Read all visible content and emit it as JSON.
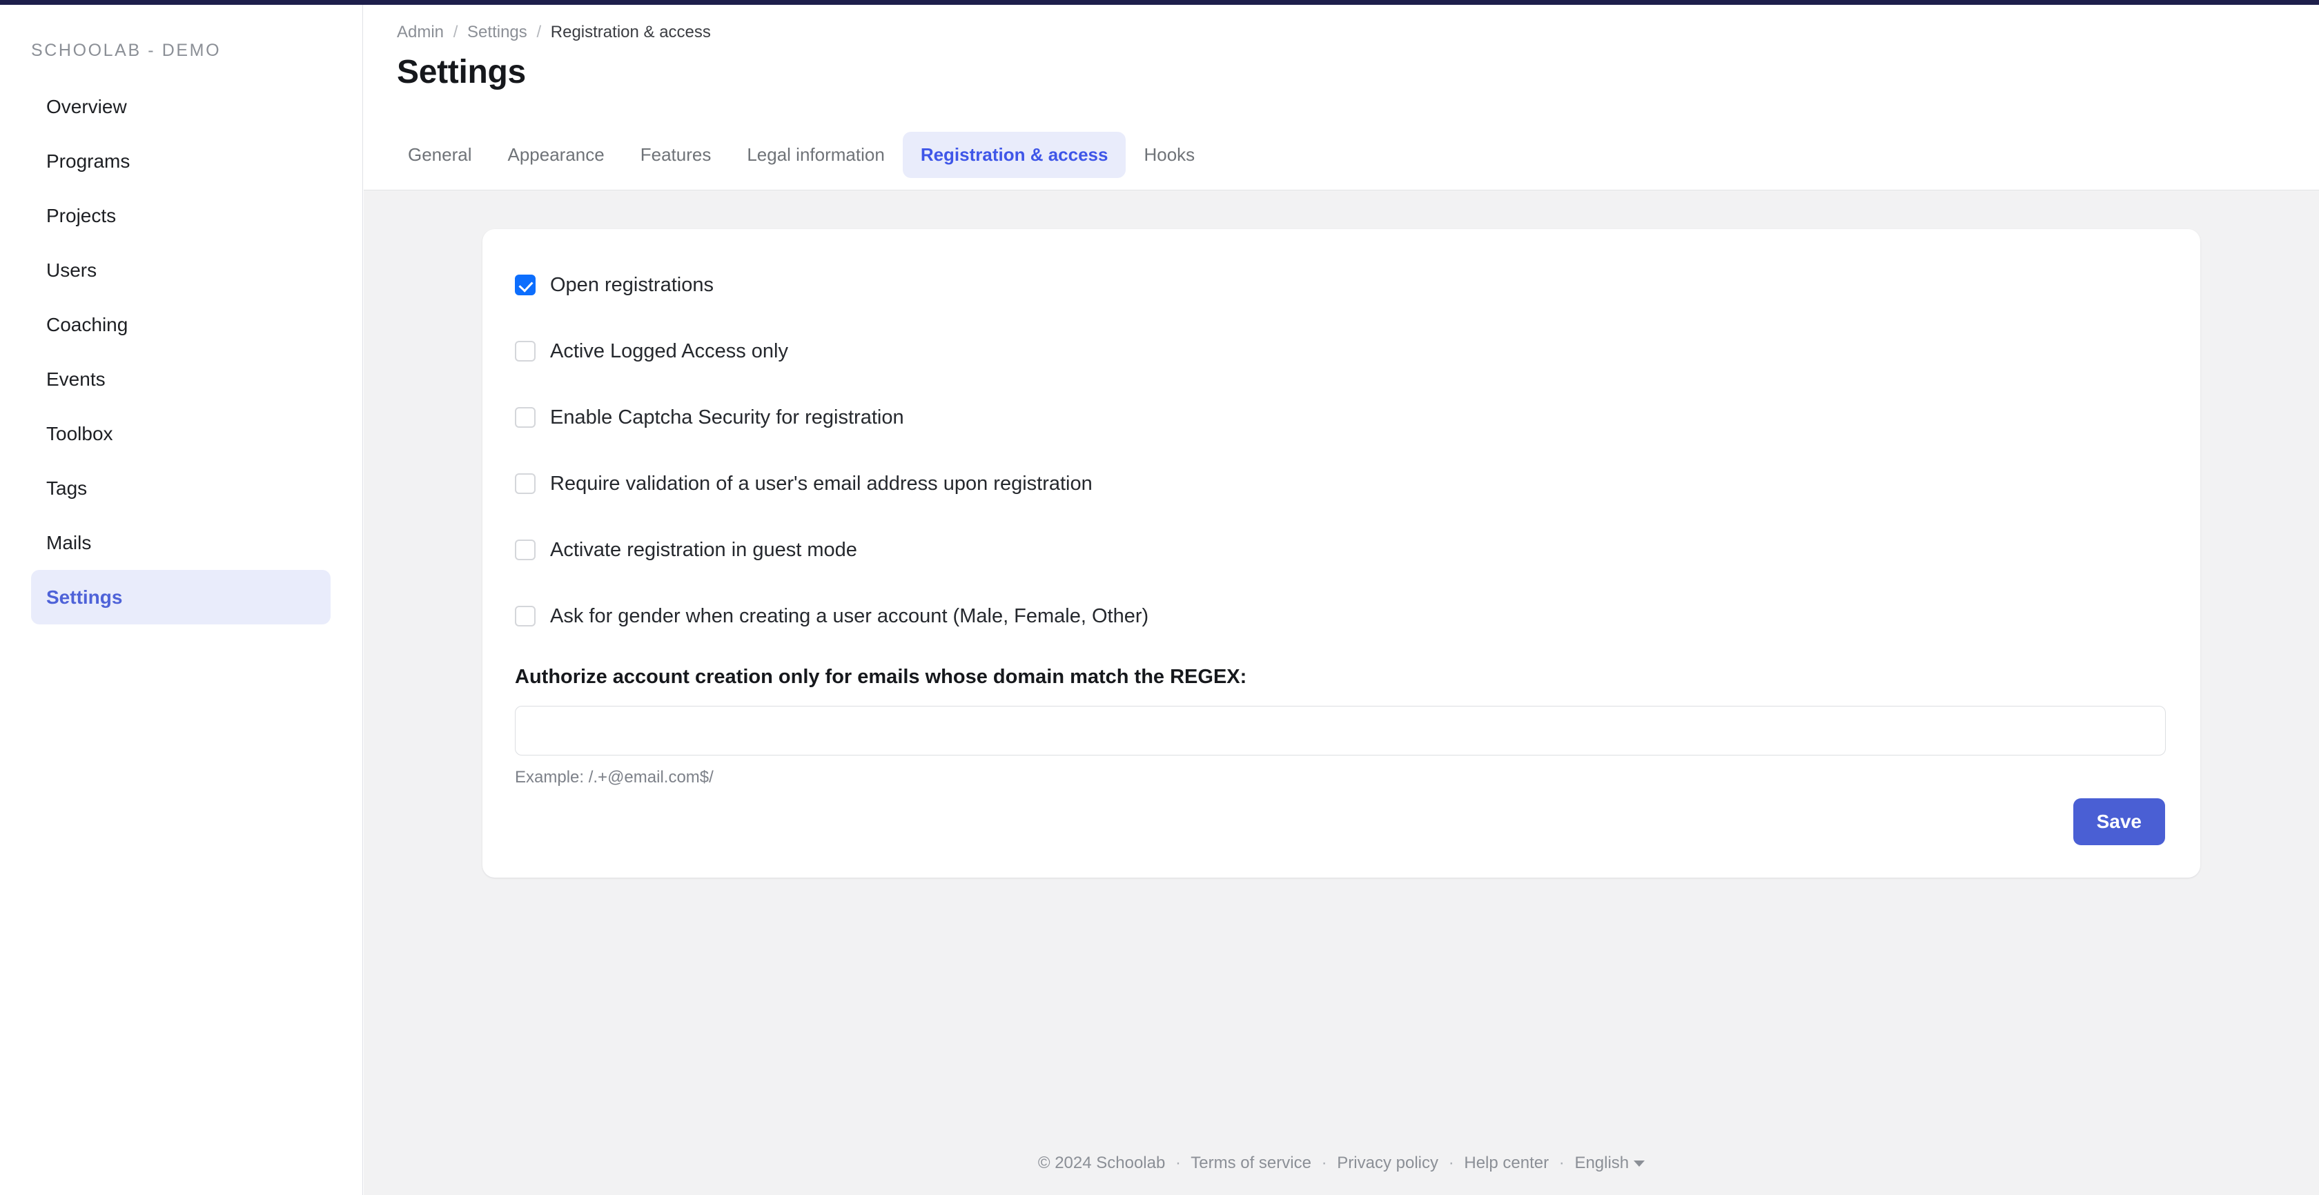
{
  "theme": {
    "accent_navy": "#1e1f4b",
    "accent_blue": "#4a5fd4",
    "active_tab_bg": "#e9ecfb",
    "active_tab_text": "#3f56e8",
    "checkbox_checked": "#0d6efd",
    "page_bg": "#f2f2f3"
  },
  "sidebar": {
    "brand": "SCHOOLAB - DEMO",
    "items": [
      {
        "label": "Overview",
        "active": false
      },
      {
        "label": "Programs",
        "active": false
      },
      {
        "label": "Projects",
        "active": false
      },
      {
        "label": "Users",
        "active": false
      },
      {
        "label": "Coaching",
        "active": false
      },
      {
        "label": "Events",
        "active": false
      },
      {
        "label": "Toolbox",
        "active": false
      },
      {
        "label": "Tags",
        "active": false
      },
      {
        "label": "Mails",
        "active": false
      },
      {
        "label": "Settings",
        "active": true
      }
    ]
  },
  "header": {
    "breadcrumb": {
      "root": "Admin",
      "parent": "Settings",
      "current": "Registration & access",
      "separator": "/"
    },
    "title": "Settings",
    "tabs": [
      {
        "label": "General",
        "active": false
      },
      {
        "label": "Appearance",
        "active": false
      },
      {
        "label": "Features",
        "active": false
      },
      {
        "label": "Legal information",
        "active": false
      },
      {
        "label": "Registration & access",
        "active": true
      },
      {
        "label": "Hooks",
        "active": false
      }
    ]
  },
  "form": {
    "checkboxes": [
      {
        "label": "Open registrations",
        "checked": true
      },
      {
        "label": "Active Logged Access only",
        "checked": false
      },
      {
        "label": "Enable Captcha Security for registration",
        "checked": false
      },
      {
        "label": "Require validation of a user's email address upon registration",
        "checked": false
      },
      {
        "label": "Activate registration in guest mode",
        "checked": false
      },
      {
        "label": "Ask for gender when creating a user account (Male, Female, Other)",
        "checked": false
      }
    ],
    "regex": {
      "label": "Authorize account creation only for emails whose domain match the REGEX:",
      "value": "",
      "placeholder": "",
      "help": "Example: /.+@email.com$/"
    },
    "save_label": "Save"
  },
  "footer": {
    "copyright": "© 2024 Schoolab",
    "terms": "Terms of service",
    "privacy": "Privacy policy",
    "help": "Help center",
    "language": "English",
    "separator": "·"
  }
}
